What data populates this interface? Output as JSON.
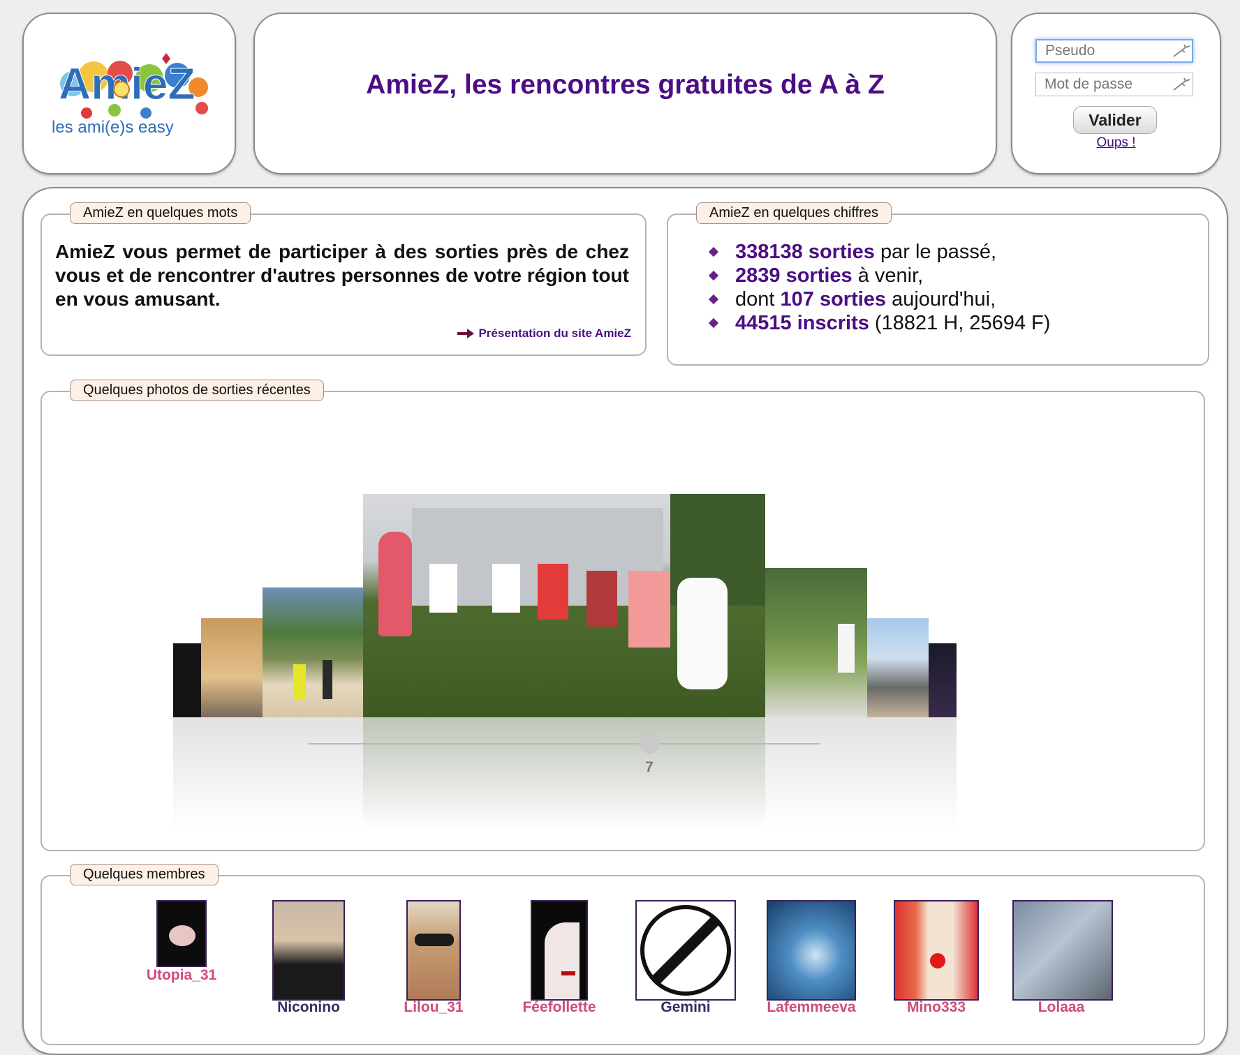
{
  "header": {
    "title": "AmieZ, les rencontres gratuites de A à Z",
    "logo_text": "AmieZ",
    "logo_tagline": "les ami(e)s easy"
  },
  "login": {
    "pseudo_placeholder": "Pseudo",
    "password_placeholder": "Mot de passe",
    "submit_label": "Valider",
    "forgot_label": "Oups !"
  },
  "about": {
    "legend": "AmieZ en quelques mots",
    "text": "AmieZ vous permet de participer à des sorties près de chez vous et de rencontrer d'autres personnes de votre région tout en vous amusant.",
    "link_label": "Présentation du site AmieZ"
  },
  "figures": {
    "legend": "AmieZ en quelques chiffres",
    "items": [
      {
        "highlight": "338138 sorties",
        "prefix": "",
        "suffix": " par le passé,"
      },
      {
        "highlight": "2839 sorties",
        "prefix": "",
        "suffix": " à venir,"
      },
      {
        "highlight": "107 sorties",
        "prefix": "dont ",
        "suffix": " aujourd'hui,"
      },
      {
        "highlight": "44515 inscrits",
        "prefix": "",
        "suffix": " (18821 H, 25694 F)"
      }
    ]
  },
  "photos": {
    "legend": "Quelques photos de sorties récentes",
    "current_index": "7"
  },
  "members": {
    "legend": "Quelques membres",
    "items": [
      {
        "name": "Utopia_31",
        "color": "#d04a7c"
      },
      {
        "name": "Niconino",
        "color": "#2f2f5f"
      },
      {
        "name": "Lilou_31",
        "color": "#d04a7c"
      },
      {
        "name": "Féefollette",
        "color": "#d04a7c"
      },
      {
        "name": "Gemini",
        "color": "#2f2f5f"
      },
      {
        "name": "Lafemmeeva",
        "color": "#d04a7c"
      },
      {
        "name": "Mino333",
        "color": "#d04a7c"
      },
      {
        "name": "Lolaaa",
        "color": "#d04a7c"
      }
    ]
  },
  "colors": {
    "brand_purple": "#4b0e83",
    "pink_name": "#d04a7c",
    "navy_name": "#2f2f5f"
  }
}
